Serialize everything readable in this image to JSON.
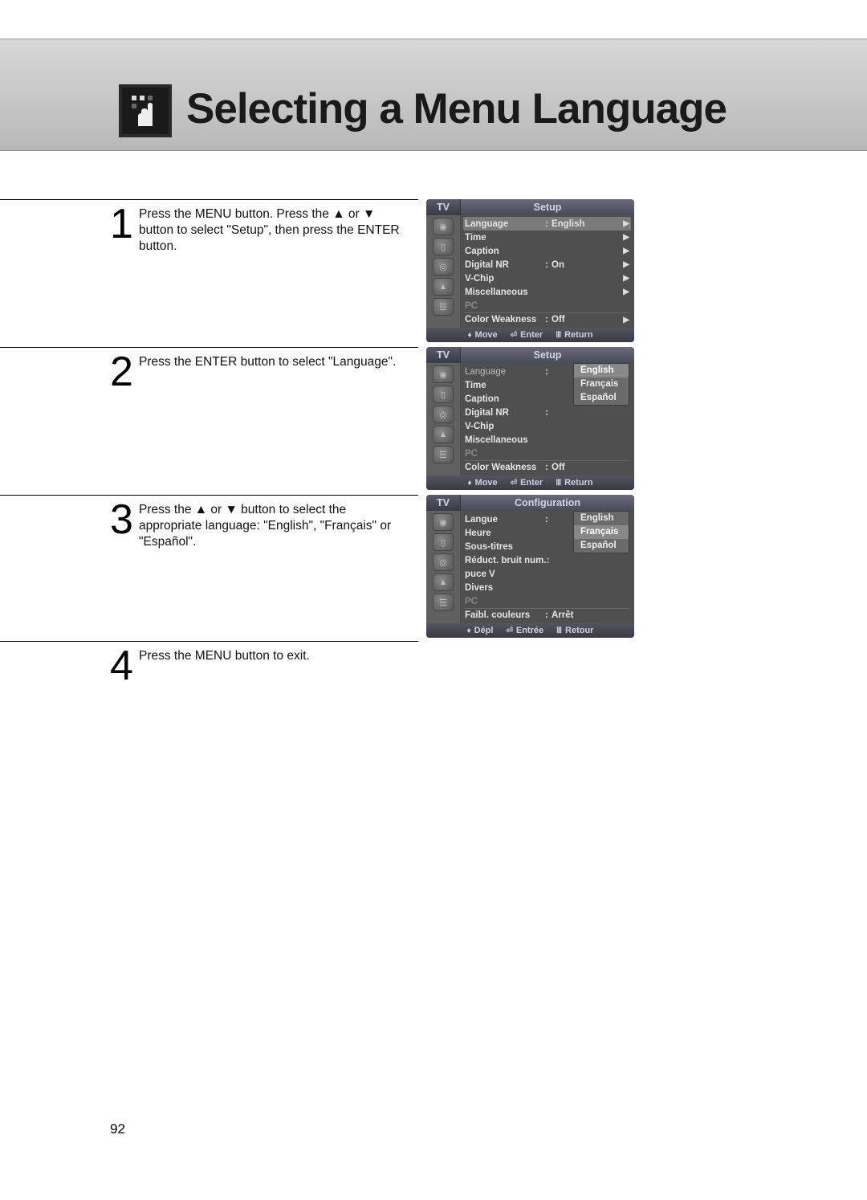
{
  "page": {
    "title": "Selecting a Menu Language",
    "number": "92"
  },
  "steps": {
    "s1": {
      "num": "1",
      "text": "Press the MENU button. Press the ▲ or ▼ button to select \"Setup\", then press the ENTER button."
    },
    "s2": {
      "num": "2",
      "text": "Press the ENTER button to select \"Language\"."
    },
    "s3": {
      "num": "3",
      "text": "Press the ▲ or ▼ button to select the appropriate language: \"English\", \"Français\" or \"Español\"."
    },
    "s4": {
      "num": "4",
      "text": "Press the MENU button to exit."
    }
  },
  "osd1": {
    "tv": "TV",
    "title": "Setup",
    "rows": {
      "language": "Language",
      "language_val": "English",
      "time": "Time",
      "caption": "Caption",
      "digitalnr": "Digital NR",
      "digitalnr_val": "On",
      "vchip": "V-Chip",
      "misc": "Miscellaneous",
      "pc": "PC",
      "colorweak": "Color Weakness",
      "colorweak_val": "Off"
    },
    "footer": {
      "move": "Move",
      "enter": "Enter",
      "return": "Return"
    }
  },
  "osd2": {
    "tv": "TV",
    "title": "Setup",
    "rows": {
      "language": "Language",
      "time": "Time",
      "caption": "Caption",
      "digitalnr": "Digital NR",
      "vchip": "V-Chip",
      "misc": "Miscellaneous",
      "pc": "PC",
      "colorweak": "Color Weakness",
      "colorweak_val": "Off"
    },
    "options": {
      "english": "English",
      "francais": "Français",
      "espanol": "Español"
    },
    "footer": {
      "move": "Move",
      "enter": "Enter",
      "return": "Return"
    }
  },
  "osd3": {
    "tv": "TV",
    "title": "Configuration",
    "rows": {
      "langue": "Langue",
      "heure": "Heure",
      "soustitres": "Sous-titres",
      "reduct": "Réduct. bruit num.",
      "puce": "puce V",
      "divers": "Divers",
      "pc": "PC",
      "faibl": "Faibl. couleurs",
      "faibl_val": "Arrêt"
    },
    "options": {
      "english": "English",
      "francais": "Français",
      "espanol": "Español"
    },
    "footer": {
      "depl": "Dépl",
      "entree": "Entrée",
      "retour": "Retour"
    }
  }
}
